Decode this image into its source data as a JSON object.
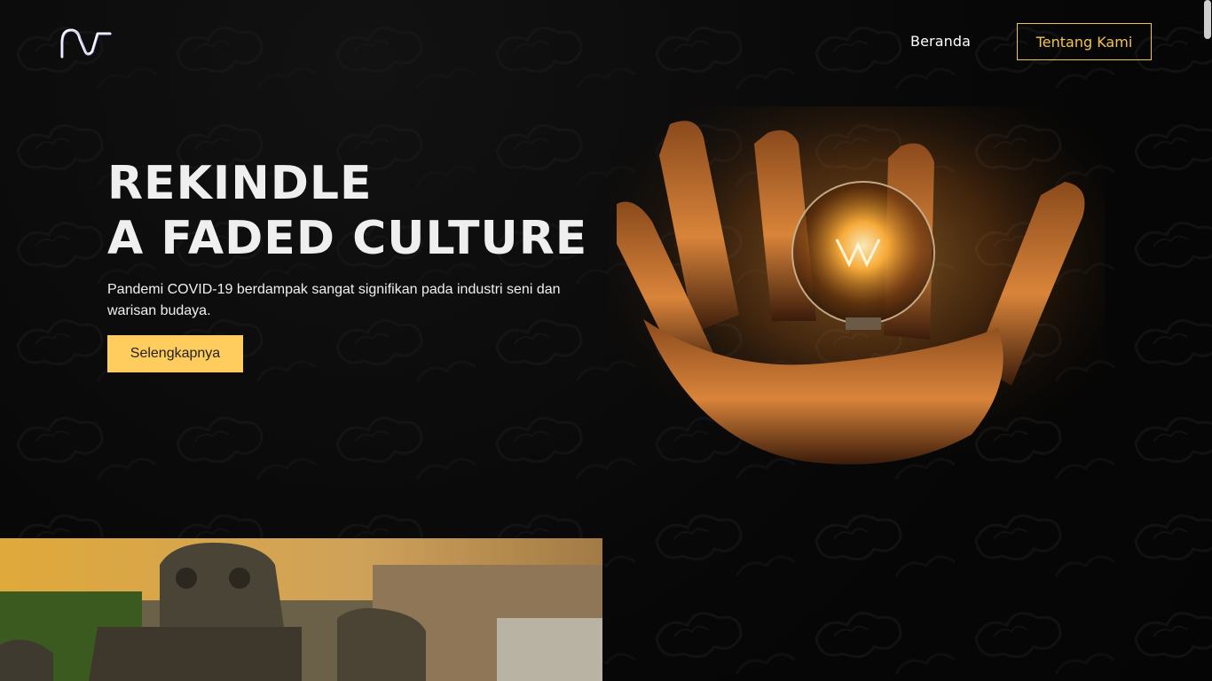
{
  "navbar": {
    "logo_alt": "NT",
    "links": [
      {
        "label": "Beranda"
      },
      {
        "label": "Tentang Kami"
      }
    ],
    "accent_color": "#f5c354"
  },
  "hero": {
    "title_line1": "REKINDLE",
    "title_line2": "A FADED CULTURE",
    "description": "Pandemi COVID-19 berdampak sangat signifikan pada industri seni dan warisan budaya.",
    "cta_label": "Selengkapnya",
    "cta_color": "#ffcc5e",
    "image": "hand-holding-lightbulb"
  },
  "section_image": "temple-stone-carvings",
  "background_color": "#070707"
}
